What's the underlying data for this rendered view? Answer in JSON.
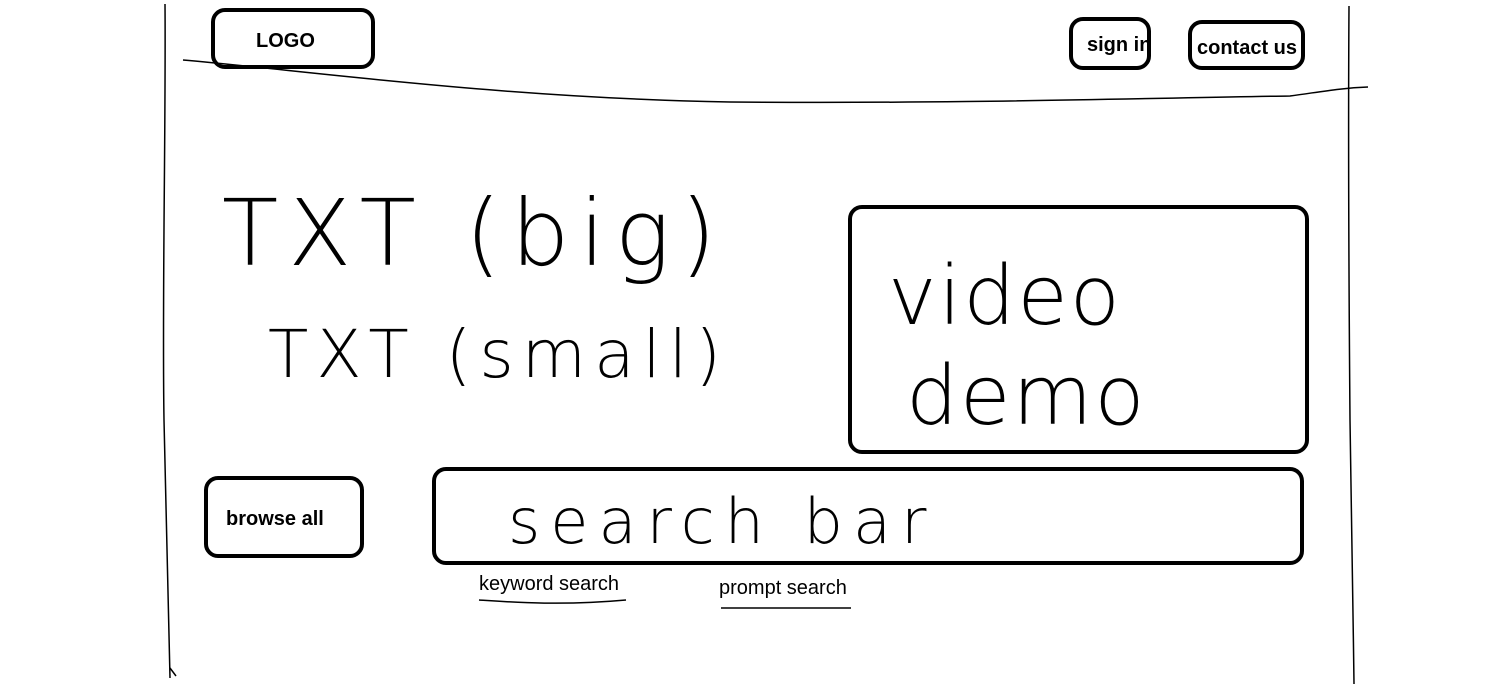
{
  "header": {
    "logo": "LOGO",
    "sign_in": "sign in",
    "contact": "contact us"
  },
  "hero": {
    "big_text": "TXT (big)",
    "small_text": "TXT (small)"
  },
  "video": {
    "label_line1": "video",
    "label_line2": "demo"
  },
  "actions": {
    "browse_all": "browse all"
  },
  "search": {
    "placeholder": "search bar",
    "keyword_link": "keyword search",
    "prompt_link": "prompt search"
  }
}
